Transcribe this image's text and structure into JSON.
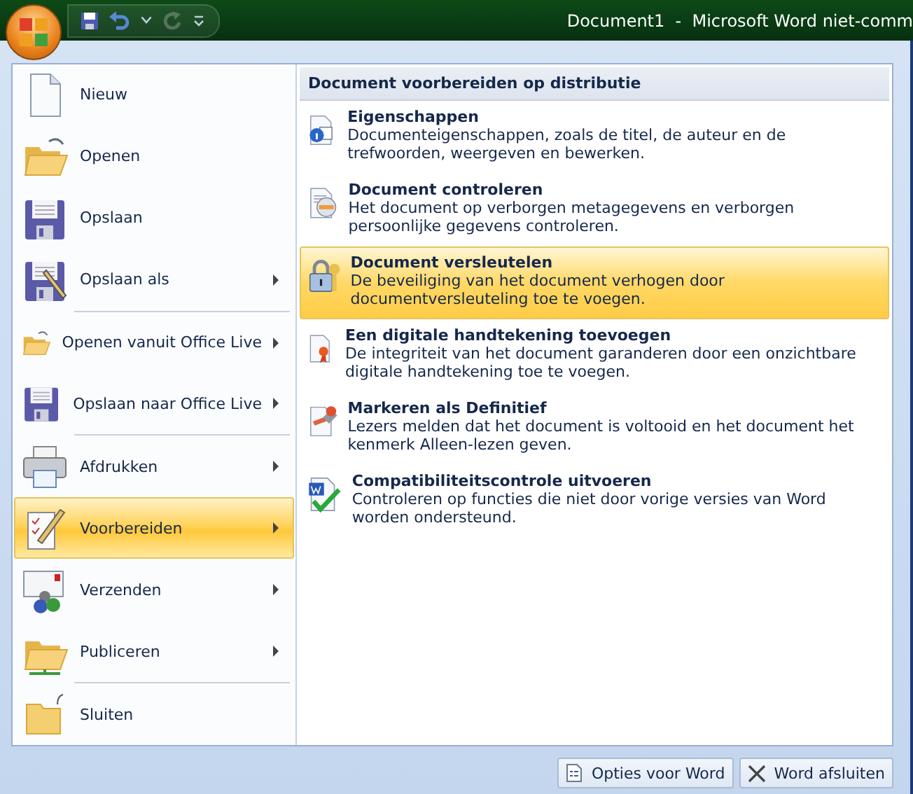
{
  "title_bar": {
    "title": "Document1  -  Microsoft Word niet-comm"
  },
  "quick_access": [
    {
      "kind": "save",
      "disabled": false
    },
    {
      "kind": "undo",
      "disabled": false
    },
    {
      "kind": "dropdown",
      "disabled": false
    },
    {
      "kind": "redo",
      "disabled": true
    },
    {
      "kind": "customize",
      "disabled": false
    }
  ],
  "menu": {
    "items": [
      {
        "label": "Nieuw",
        "kind": "new",
        "submenu": false,
        "separator_before": false,
        "selected": false
      },
      {
        "label": "Openen",
        "kind": "open",
        "submenu": false,
        "separator_before": false,
        "selected": false
      },
      {
        "label": "Opslaan",
        "kind": "save",
        "submenu": false,
        "separator_before": false,
        "selected": false
      },
      {
        "label": "Opslaan als",
        "kind": "saveas",
        "submenu": true,
        "separator_before": false,
        "selected": false
      },
      {
        "label": "Openen vanuit Office Live",
        "kind": "open",
        "submenu": true,
        "separator_before": true,
        "selected": false
      },
      {
        "label": "Opslaan naar Office Live",
        "kind": "save",
        "submenu": true,
        "separator_before": false,
        "selected": false
      },
      {
        "label": "Afdrukken",
        "kind": "print",
        "submenu": true,
        "separator_before": true,
        "selected": false
      },
      {
        "label": "Voorbereiden",
        "kind": "prepare",
        "submenu": true,
        "separator_before": false,
        "selected": true
      },
      {
        "label": "Verzenden",
        "kind": "send",
        "submenu": true,
        "separator_before": false,
        "selected": false
      },
      {
        "label": "Publiceren",
        "kind": "publish",
        "submenu": true,
        "separator_before": false,
        "selected": false
      },
      {
        "label": "Sluiten",
        "kind": "close",
        "submenu": false,
        "separator_before": true,
        "selected": false
      }
    ]
  },
  "submenu": {
    "title": "Document voorbereiden op distributie",
    "items": [
      {
        "kind": "properties",
        "title": "Eigenschappen",
        "description": "Documenteigenschappen, zoals de titel, de auteur en de trefwoorden, weergeven en bewerken.",
        "selected": false
      },
      {
        "kind": "inspect",
        "title": "Document controleren",
        "description": "Het document op verborgen metagegevens en verborgen persoonlijke gegevens controleren.",
        "selected": false
      },
      {
        "kind": "encrypt",
        "title": "Document versleutelen",
        "description": "De beveiliging van het document verhogen door documentversleuteling toe te voegen.",
        "selected": true
      },
      {
        "kind": "signature",
        "title": "Een digitale handtekening toevoegen",
        "description": "De integriteit van het document garanderen door een onzichtbare digitale handtekening toe te voegen.",
        "selected": false
      },
      {
        "kind": "final",
        "title": "Markeren als Definitief",
        "description": "Lezers melden dat het document is voltooid en het document het kenmerk Alleen-lezen geven.",
        "selected": false
      },
      {
        "kind": "compat",
        "title": "Compatibiliteitscontrole uitvoeren",
        "description": "Controleren op functies die niet door vorige versies van Word worden ondersteund.",
        "selected": false
      }
    ]
  },
  "footer_buttons": [
    {
      "kind": "options",
      "label": "Opties voor Word"
    },
    {
      "kind": "exit",
      "label": "Word afsluiten"
    }
  ]
}
